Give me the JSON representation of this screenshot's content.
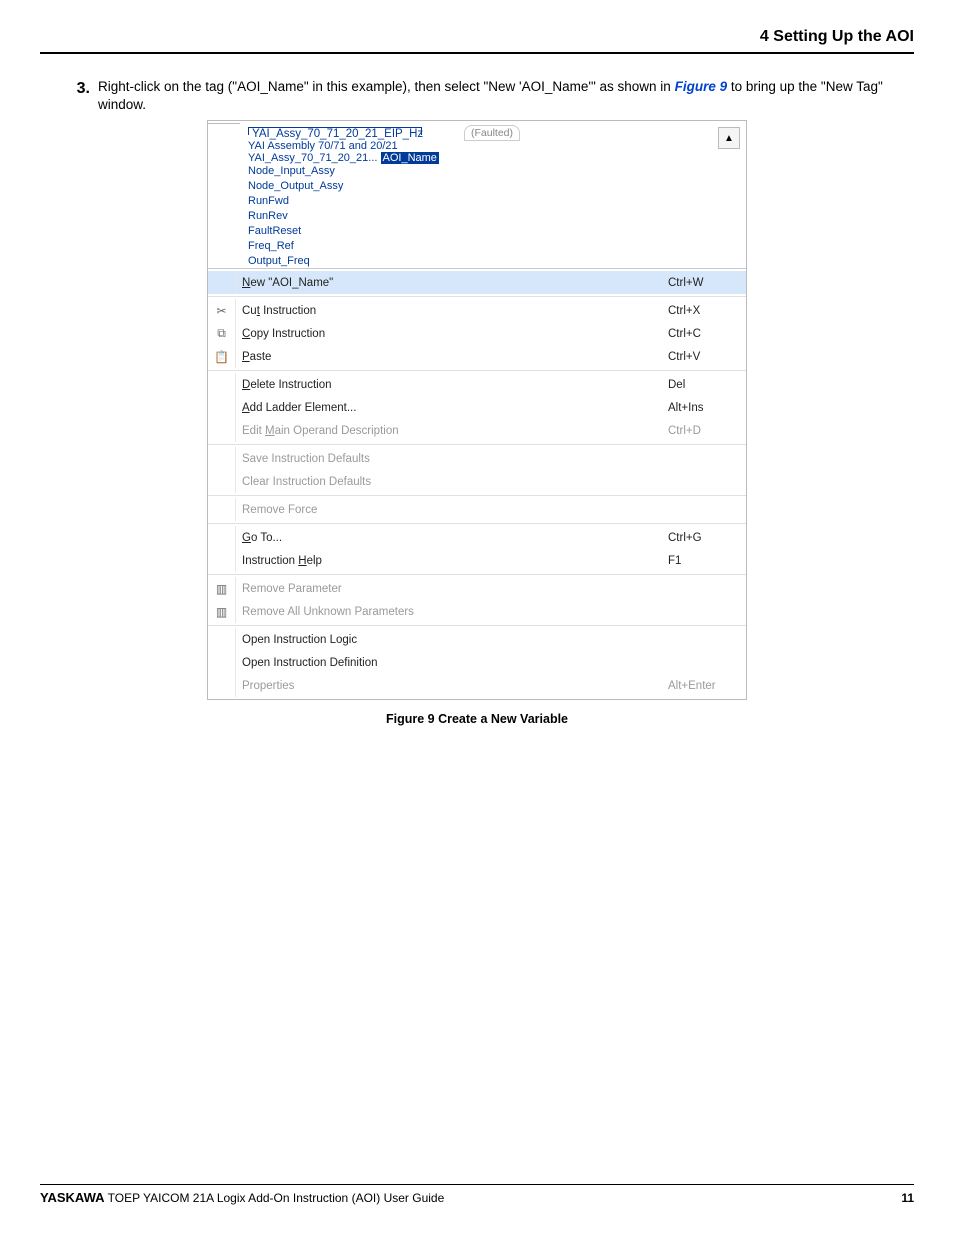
{
  "header": {
    "section": "4 Setting Up the AOI"
  },
  "step": {
    "num": "3.",
    "pre": "Right-click on the tag (\"AOI_Name\" in this example), then select \"New 'AOI_Name'\" as shown in ",
    "link": "Figure 9",
    "post": "to bring up the \"New Tag\" window."
  },
  "fig": {
    "tag_title": "YAI_Assy_70_71_20_21_EIP_Hz",
    "tag_sub": "YAI Assembly 70/71 and 20/21",
    "tag_row_prefix": "YAI_Assy_70_71_20_21...",
    "tag_selected": "AOI_Name",
    "params": [
      "Node_Input_Assy",
      "Node_Output_Assy",
      "RunFwd",
      "RunRev",
      "FaultReset",
      "Freq_Ref",
      "Output_Freq"
    ],
    "faulted": "(Faulted)",
    "arrow": "▲"
  },
  "menu": {
    "g1": [
      {
        "icon": "",
        "label": "New \"AOI_Name\"",
        "short": "Ctrl+W",
        "hl": true,
        "u": "N"
      }
    ],
    "g2": [
      {
        "icon": "✂",
        "label": "Cut Instruction",
        "short": "Ctrl+X",
        "u": "t"
      },
      {
        "icon": "⧉",
        "label": "Copy Instruction",
        "short": "Ctrl+C",
        "u": "C"
      },
      {
        "icon": "📋",
        "label": "Paste",
        "short": "Ctrl+V",
        "u": "P"
      }
    ],
    "g3": [
      {
        "icon": "",
        "label": "Delete Instruction",
        "short": "Del",
        "u": "D"
      },
      {
        "icon": "",
        "label": "Add Ladder Element...",
        "short": "Alt+Ins",
        "u": "A"
      },
      {
        "icon": "",
        "label": "Edit Main Operand Description",
        "short": "Ctrl+D",
        "dis": true,
        "u": "M"
      }
    ],
    "g4": [
      {
        "icon": "",
        "label": "Save Instruction Defaults",
        "short": "",
        "dis": true
      },
      {
        "icon": "",
        "label": "Clear Instruction Defaults",
        "short": "",
        "dis": true
      }
    ],
    "g5": [
      {
        "icon": "",
        "label": "Remove Force",
        "short": "",
        "dis": true
      }
    ],
    "g6": [
      {
        "icon": "",
        "label": "Go To...",
        "short": "Ctrl+G",
        "u": "G"
      },
      {
        "icon": "",
        "label": "Instruction Help",
        "short": "F1",
        "u": "H"
      }
    ],
    "g7": [
      {
        "icon": "▥",
        "label": "Remove Parameter",
        "short": "",
        "dis": true
      },
      {
        "icon": "▥",
        "label": "Remove All Unknown Parameters",
        "short": "",
        "dis": true
      }
    ],
    "g8": [
      {
        "icon": "",
        "label": "Open Instruction Logic",
        "short": ""
      },
      {
        "icon": "",
        "label": "Open Instruction Definition",
        "short": ""
      },
      {
        "icon": "",
        "label": "Properties",
        "short": "Alt+Enter",
        "dis": true
      }
    ]
  },
  "caption": "Figure 9  Create a New Variable",
  "footer": {
    "brand": "YASKAWA",
    "doc": " TOEP YAICOM 21A Logix Add-On Instruction (AOI) User Guide",
    "page": "11"
  }
}
